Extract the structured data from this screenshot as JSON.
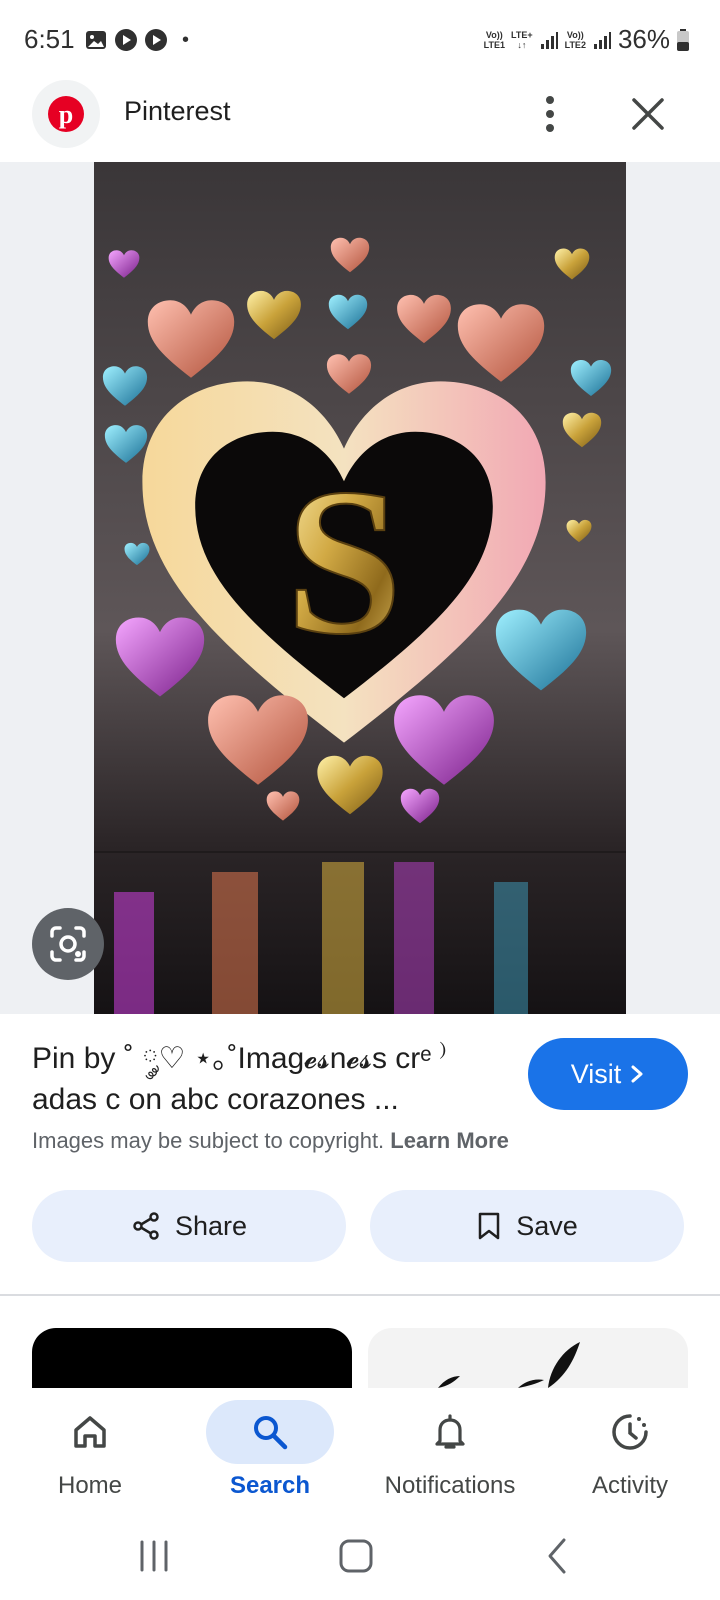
{
  "status_bar": {
    "time": "6:51",
    "dot": "•",
    "net1": [
      "Vo))",
      "LTE1"
    ],
    "net_mid": [
      "LTE+",
      "↓↑"
    ],
    "net2": [
      "Vo))",
      "LTE2"
    ],
    "battery": "36%"
  },
  "header": {
    "title": "Pinterest",
    "logo_letter": "p"
  },
  "pin": {
    "title": "Pin by ˚ ༘♡ ⋆｡˚Imag𝓮𝓼n𝓮𝓼s crᵉ ⁾adas c on abc corazones ...",
    "visit_label": "Visit",
    "copyright_text": "Images may be subject to copyright.",
    "learn_more": "Learn More",
    "share_label": "Share",
    "save_label": "Save"
  },
  "image": {
    "letter": "S"
  },
  "nav": {
    "items": [
      {
        "label": "Home",
        "icon": "home-icon",
        "active": false
      },
      {
        "label": "Search",
        "icon": "search-icon",
        "active": true
      },
      {
        "label": "Notifications",
        "icon": "bell-icon",
        "active": false
      },
      {
        "label": "Activity",
        "icon": "activity-icon",
        "active": false
      }
    ]
  },
  "colors": {
    "accent": "#1a73e8",
    "pinterest_red": "#e60023",
    "chip_bg": "#e8effc"
  }
}
